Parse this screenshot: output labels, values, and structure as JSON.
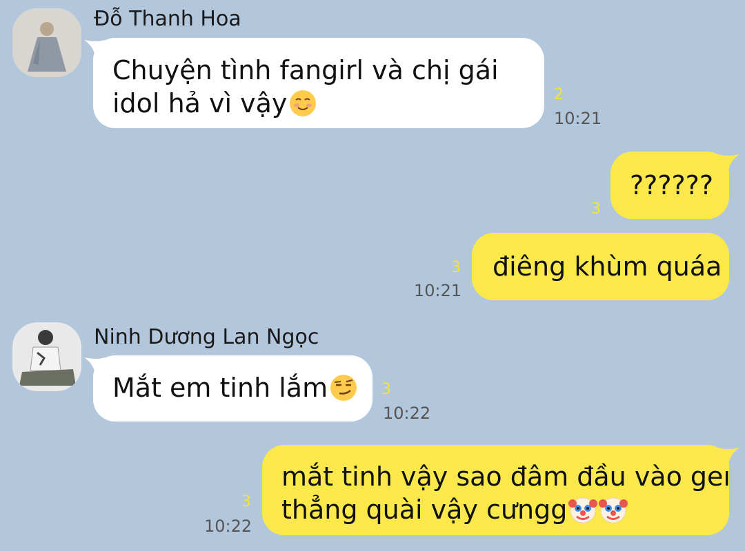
{
  "messages": [
    {
      "sender": "Đỗ Thanh Hoa",
      "line1": "Chuyện tình fangirl và chị gái",
      "line2": "idol hả vì vậy",
      "emoji": "smiling-face-icon",
      "count": "2",
      "time": "10:21"
    },
    {
      "text": "??????",
      "count": "3"
    },
    {
      "text": "điêng khùm quáa",
      "count": "3",
      "time": "10:21"
    },
    {
      "sender": "Ninh Dương Lan Ngọc",
      "text": "Mắt em tinh lắm",
      "emoji": "smirking-face-icon",
      "count": "3",
      "time": "10:22"
    },
    {
      "line1": "mắt tinh vậy sao đâm đầu vào gei",
      "line2": "thẳng quài vậy cưngg",
      "emoji": "clown-face-icon",
      "count": "3",
      "time": "10:22"
    }
  ],
  "colors": {
    "background": "#b3c7dc",
    "incoming_bubble": "#ffffff",
    "outgoing_bubble": "#fbe94c",
    "read_count": "#f2e23b",
    "time": "#555555"
  }
}
